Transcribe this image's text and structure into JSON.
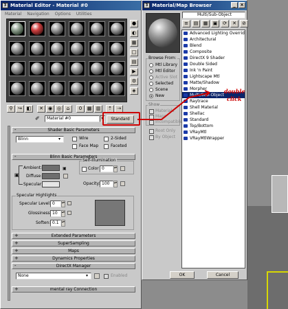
{
  "bg_viewport": {
    "colors": [
      "#7a7a7a",
      "#909090"
    ]
  },
  "editor": {
    "title": "Material Editor - Material #0",
    "menu": [
      "Material",
      "Navigation",
      "Options",
      "Utilities"
    ],
    "material_name": "Material #0",
    "type_button": "Standard",
    "rollouts": {
      "shader_basic": "Shader Basic Parameters",
      "blinn_basic": "Blinn Basic Parameters",
      "extended": "Extended Parameters",
      "supersampling": "SuperSampling",
      "maps": "Maps",
      "dynamics": "Dynamics Properties",
      "directx": "DirectX Manager",
      "mental_ray": "mental ray Connection"
    },
    "shader": {
      "value": "Blinn",
      "wire": "Wire",
      "two_sided": "2-Sided",
      "face_map": "Face Map",
      "faceted": "Faceted"
    },
    "blinn": {
      "ambient": "Ambient:",
      "diffuse": "Diffuse:",
      "specular": "Specular:",
      "self_illum": "Self-Illumination",
      "color": "Color",
      "color_value": "0",
      "opacity": "Opacity:",
      "opacity_value": "100"
    },
    "highlights": {
      "group": "Specular Highlights",
      "level_label": "Specular Level:",
      "level_value": "0",
      "gloss_label": "Glossiness:",
      "gloss_value": "10",
      "soften_label": "Soften:",
      "soften_value": "0.1"
    },
    "dx": {
      "value": "None",
      "enabled": "Enabled"
    }
  },
  "browser": {
    "title": "Material/Map Browser",
    "header": "Multi/Sub-Object",
    "browse_from": {
      "label": "Browse From:",
      "options": [
        "Mtl Library",
        "Mtl Editor",
        "Active Slot",
        "Selected",
        "Scene",
        "New"
      ],
      "selected": "New"
    },
    "show": {
      "label": "Show",
      "options": [
        "Materials",
        "Maps",
        "Incompatible"
      ]
    },
    "extra": [
      "Root Only",
      "By Object"
    ],
    "items": [
      "Advanced Lighting Override",
      "Architectural",
      "Blend",
      "Composite",
      "DirectX 9 Shader",
      "Double Sided",
      "Ink 'n Paint",
      "Lightscape Mtl",
      "Matte/Shadow",
      "Morpher",
      "Multi/Sub-Object",
      "Raytrace",
      "Shell Material",
      "Shellac",
      "Standard",
      "Top/Bottom",
      "VRayMtl",
      "VRayMtlWrapper"
    ],
    "selected": "Multi/Sub-Object",
    "ok": "OK",
    "cancel": "Cancel"
  },
  "annotation": {
    "text1": "double",
    "text2": "click",
    "color": "#cc0000"
  }
}
